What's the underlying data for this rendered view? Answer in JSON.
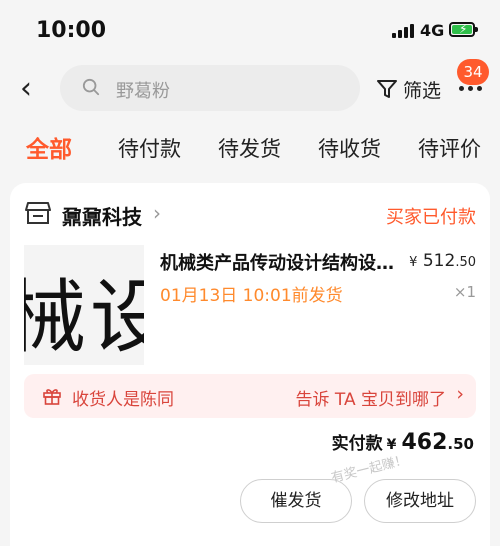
{
  "status_bar": {
    "time": "10:00",
    "network": "4G"
  },
  "header": {
    "search_placeholder": "野葛粉",
    "filter_label": "筛选",
    "more_badge": "34"
  },
  "tabs": [
    {
      "label": "全部",
      "active": true
    },
    {
      "label": "待付款"
    },
    {
      "label": "待发货"
    },
    {
      "label": "待收货"
    },
    {
      "label": "待评价"
    }
  ],
  "order": {
    "shop_name": "鼐鼐科技",
    "status": "买家已付款",
    "thumbnail_text": "械设",
    "product_title": "机械类产品传动设计结构设…",
    "price": {
      "currency": "¥",
      "integer": "512",
      "decimal": ".50"
    },
    "ship_time": "01月13日 10:01前发货",
    "quantity": "×1",
    "gift": {
      "receiver": "收货人是陈同",
      "action": "告诉 TA 宝贝到哪了"
    },
    "paid": {
      "label": "实付款",
      "currency": "¥",
      "integer": "462",
      "decimal": ".50"
    },
    "buttons": {
      "urge": "催发货",
      "change_address": "修改地址"
    }
  },
  "watermark": "有奖一起赚！",
  "colors": {
    "accent": "#ff5a2d",
    "gift_bg": "#fff0f0",
    "gift_text": "#d9453c"
  }
}
